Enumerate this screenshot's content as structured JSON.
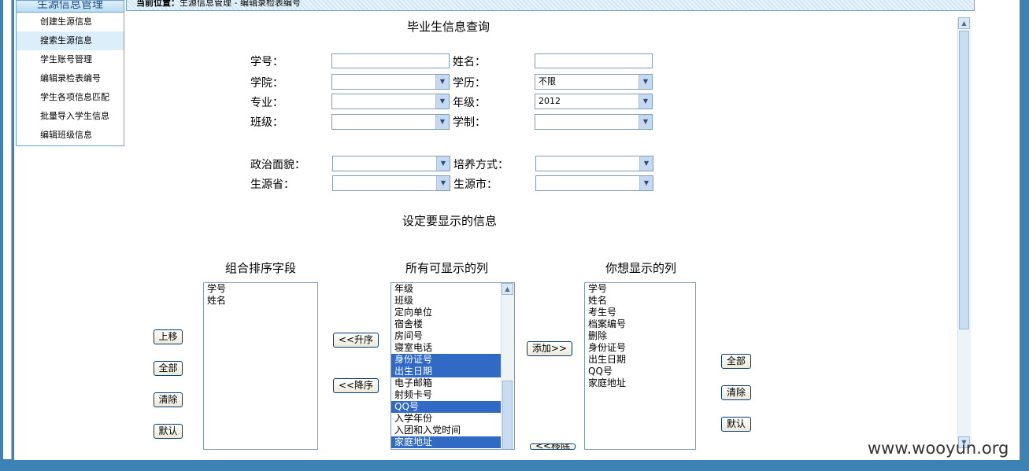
{
  "sidebar": {
    "title": "生源信息管理",
    "items": [
      {
        "label": "创建生源信息"
      },
      {
        "label": "搜索生源信息"
      },
      {
        "label": "学生账号管理"
      },
      {
        "label": "编辑录检表编号"
      },
      {
        "label": "学生各项信息匹配"
      },
      {
        "label": "批量导入学生信息"
      },
      {
        "label": "编辑班级信息"
      }
    ]
  },
  "breadcrumb": {
    "prefix": "当前位置：",
    "path": "生源信息管理 -   编辑录检表编号"
  },
  "query": {
    "title": "毕业生信息查询",
    "student_id_label": "学号：",
    "name_label": "姓名：",
    "college_label": "学院：",
    "degree_label": "学历：",
    "degree_value": "不限",
    "major_label": "专业：",
    "grade_label": "年级：",
    "grade_value": "2012",
    "class_label": "班级：",
    "duration_label": "学制：",
    "political_label": "政治面貌：",
    "training_label": "培养方式：",
    "province_label": "生源省：",
    "city_label": "生源市："
  },
  "display": {
    "title": "设定要显示的信息",
    "sort_fields_header": "组合排序字段",
    "all_columns_header": "所有可显示的列",
    "wanted_columns_header": "你想显示的列",
    "sort_fields": [
      "学号",
      "姓名"
    ],
    "all_columns": [
      {
        "label": "年级",
        "selected": false
      },
      {
        "label": "班级",
        "selected": false
      },
      {
        "label": "定向单位",
        "selected": false
      },
      {
        "label": "宿舍楼",
        "selected": false
      },
      {
        "label": "房间号",
        "selected": false
      },
      {
        "label": "寝室电话",
        "selected": false
      },
      {
        "label": "身份证号",
        "selected": true
      },
      {
        "label": "出生日期",
        "selected": true
      },
      {
        "label": "电子邮箱",
        "selected": false
      },
      {
        "label": "射频卡号",
        "selected": false
      },
      {
        "label": "QQ号",
        "selected": true
      },
      {
        "label": "入学年份",
        "selected": false
      },
      {
        "label": "入团和入党时间",
        "selected": false
      },
      {
        "label": "家庭地址",
        "selected": true
      }
    ],
    "wanted_columns": [
      "学号",
      "姓名",
      "考生号",
      "档案编号",
      "删除",
      "身份证号",
      "出生日期",
      "QQ号",
      "家庭地址"
    ],
    "buttons": {
      "move_up": "上移",
      "all_left": "全部",
      "clear_left": "清除",
      "default_left": "默认",
      "asc": "<<升序",
      "desc": "<<降序",
      "add": "添加>>",
      "remove": "<<移除",
      "all_right": "全部",
      "clear_right": "清除",
      "default_right": "默认"
    }
  },
  "watermark": "www.wooyun.org"
}
